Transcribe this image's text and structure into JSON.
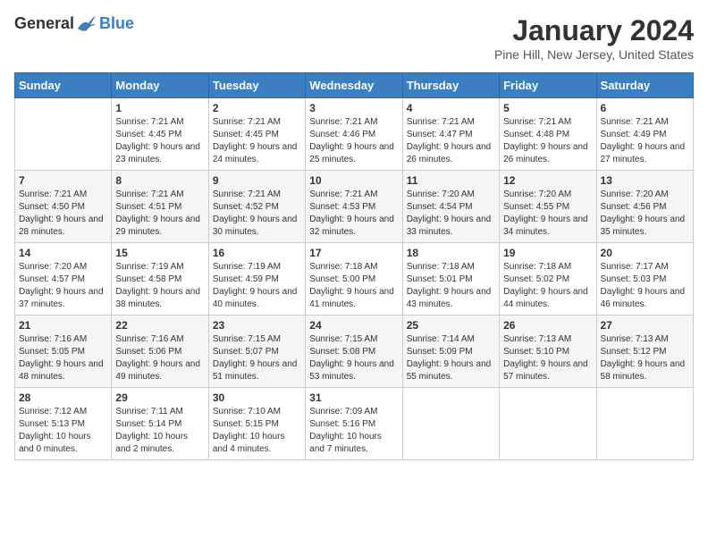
{
  "logo": {
    "general": "General",
    "blue": "Blue"
  },
  "title": "January 2024",
  "location": "Pine Hill, New Jersey, United States",
  "days_of_week": [
    "Sunday",
    "Monday",
    "Tuesday",
    "Wednesday",
    "Thursday",
    "Friday",
    "Saturday"
  ],
  "weeks": [
    [
      {
        "day": "",
        "sunrise": "",
        "sunset": "",
        "daylight": ""
      },
      {
        "day": "1",
        "sunrise": "Sunrise: 7:21 AM",
        "sunset": "Sunset: 4:45 PM",
        "daylight": "Daylight: 9 hours and 23 minutes."
      },
      {
        "day": "2",
        "sunrise": "Sunrise: 7:21 AM",
        "sunset": "Sunset: 4:45 PM",
        "daylight": "Daylight: 9 hours and 24 minutes."
      },
      {
        "day": "3",
        "sunrise": "Sunrise: 7:21 AM",
        "sunset": "Sunset: 4:46 PM",
        "daylight": "Daylight: 9 hours and 25 minutes."
      },
      {
        "day": "4",
        "sunrise": "Sunrise: 7:21 AM",
        "sunset": "Sunset: 4:47 PM",
        "daylight": "Daylight: 9 hours and 26 minutes."
      },
      {
        "day": "5",
        "sunrise": "Sunrise: 7:21 AM",
        "sunset": "Sunset: 4:48 PM",
        "daylight": "Daylight: 9 hours and 26 minutes."
      },
      {
        "day": "6",
        "sunrise": "Sunrise: 7:21 AM",
        "sunset": "Sunset: 4:49 PM",
        "daylight": "Daylight: 9 hours and 27 minutes."
      }
    ],
    [
      {
        "day": "7",
        "sunrise": "Sunrise: 7:21 AM",
        "sunset": "Sunset: 4:50 PM",
        "daylight": "Daylight: 9 hours and 28 minutes."
      },
      {
        "day": "8",
        "sunrise": "Sunrise: 7:21 AM",
        "sunset": "Sunset: 4:51 PM",
        "daylight": "Daylight: 9 hours and 29 minutes."
      },
      {
        "day": "9",
        "sunrise": "Sunrise: 7:21 AM",
        "sunset": "Sunset: 4:52 PM",
        "daylight": "Daylight: 9 hours and 30 minutes."
      },
      {
        "day": "10",
        "sunrise": "Sunrise: 7:21 AM",
        "sunset": "Sunset: 4:53 PM",
        "daylight": "Daylight: 9 hours and 32 minutes."
      },
      {
        "day": "11",
        "sunrise": "Sunrise: 7:20 AM",
        "sunset": "Sunset: 4:54 PM",
        "daylight": "Daylight: 9 hours and 33 minutes."
      },
      {
        "day": "12",
        "sunrise": "Sunrise: 7:20 AM",
        "sunset": "Sunset: 4:55 PM",
        "daylight": "Daylight: 9 hours and 34 minutes."
      },
      {
        "day": "13",
        "sunrise": "Sunrise: 7:20 AM",
        "sunset": "Sunset: 4:56 PM",
        "daylight": "Daylight: 9 hours and 35 minutes."
      }
    ],
    [
      {
        "day": "14",
        "sunrise": "Sunrise: 7:20 AM",
        "sunset": "Sunset: 4:57 PM",
        "daylight": "Daylight: 9 hours and 37 minutes."
      },
      {
        "day": "15",
        "sunrise": "Sunrise: 7:19 AM",
        "sunset": "Sunset: 4:58 PM",
        "daylight": "Daylight: 9 hours and 38 minutes."
      },
      {
        "day": "16",
        "sunrise": "Sunrise: 7:19 AM",
        "sunset": "Sunset: 4:59 PM",
        "daylight": "Daylight: 9 hours and 40 minutes."
      },
      {
        "day": "17",
        "sunrise": "Sunrise: 7:18 AM",
        "sunset": "Sunset: 5:00 PM",
        "daylight": "Daylight: 9 hours and 41 minutes."
      },
      {
        "day": "18",
        "sunrise": "Sunrise: 7:18 AM",
        "sunset": "Sunset: 5:01 PM",
        "daylight": "Daylight: 9 hours and 43 minutes."
      },
      {
        "day": "19",
        "sunrise": "Sunrise: 7:18 AM",
        "sunset": "Sunset: 5:02 PM",
        "daylight": "Daylight: 9 hours and 44 minutes."
      },
      {
        "day": "20",
        "sunrise": "Sunrise: 7:17 AM",
        "sunset": "Sunset: 5:03 PM",
        "daylight": "Daylight: 9 hours and 46 minutes."
      }
    ],
    [
      {
        "day": "21",
        "sunrise": "Sunrise: 7:16 AM",
        "sunset": "Sunset: 5:05 PM",
        "daylight": "Daylight: 9 hours and 48 minutes."
      },
      {
        "day": "22",
        "sunrise": "Sunrise: 7:16 AM",
        "sunset": "Sunset: 5:06 PM",
        "daylight": "Daylight: 9 hours and 49 minutes."
      },
      {
        "day": "23",
        "sunrise": "Sunrise: 7:15 AM",
        "sunset": "Sunset: 5:07 PM",
        "daylight": "Daylight: 9 hours and 51 minutes."
      },
      {
        "day": "24",
        "sunrise": "Sunrise: 7:15 AM",
        "sunset": "Sunset: 5:08 PM",
        "daylight": "Daylight: 9 hours and 53 minutes."
      },
      {
        "day": "25",
        "sunrise": "Sunrise: 7:14 AM",
        "sunset": "Sunset: 5:09 PM",
        "daylight": "Daylight: 9 hours and 55 minutes."
      },
      {
        "day": "26",
        "sunrise": "Sunrise: 7:13 AM",
        "sunset": "Sunset: 5:10 PM",
        "daylight": "Daylight: 9 hours and 57 minutes."
      },
      {
        "day": "27",
        "sunrise": "Sunrise: 7:13 AM",
        "sunset": "Sunset: 5:12 PM",
        "daylight": "Daylight: 9 hours and 58 minutes."
      }
    ],
    [
      {
        "day": "28",
        "sunrise": "Sunrise: 7:12 AM",
        "sunset": "Sunset: 5:13 PM",
        "daylight": "Daylight: 10 hours and 0 minutes."
      },
      {
        "day": "29",
        "sunrise": "Sunrise: 7:11 AM",
        "sunset": "Sunset: 5:14 PM",
        "daylight": "Daylight: 10 hours and 2 minutes."
      },
      {
        "day": "30",
        "sunrise": "Sunrise: 7:10 AM",
        "sunset": "Sunset: 5:15 PM",
        "daylight": "Daylight: 10 hours and 4 minutes."
      },
      {
        "day": "31",
        "sunrise": "Sunrise: 7:09 AM",
        "sunset": "Sunset: 5:16 PM",
        "daylight": "Daylight: 10 hours and 7 minutes."
      },
      {
        "day": "",
        "sunrise": "",
        "sunset": "",
        "daylight": ""
      },
      {
        "day": "",
        "sunrise": "",
        "sunset": "",
        "daylight": ""
      },
      {
        "day": "",
        "sunrise": "",
        "sunset": "",
        "daylight": ""
      }
    ]
  ]
}
